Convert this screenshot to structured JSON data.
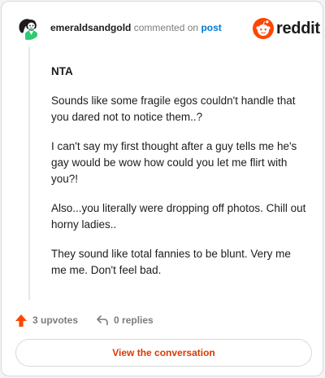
{
  "comment": {
    "username": "emeraldsandgold",
    "action_text": "commented on",
    "link_text": "post",
    "verdict": "NTA",
    "paragraphs": [
      "Sounds like some fragile egos couldn't handle that you dared not to notice them..?",
      "I can't say my first thought after a guy tells me he's gay would be wow how could you let me flirt with you?!",
      "Also...you literally were dropping off photos. Chill out horny ladies..",
      "They sound like total fannies to be blunt. Very me me me. Don't feel bad."
    ]
  },
  "brand": {
    "wordmark": "reddit",
    "color": "#ff4500",
    "icon": "reddit-snoo-icon"
  },
  "actions": {
    "upvotes_label": "3 upvotes",
    "replies_label": "0 replies",
    "upvote_icon": "upvote-arrow-icon",
    "reply_icon": "reply-arrow-icon",
    "upvote_color": "#ff4500"
  },
  "view_button_label": "View the conversation"
}
